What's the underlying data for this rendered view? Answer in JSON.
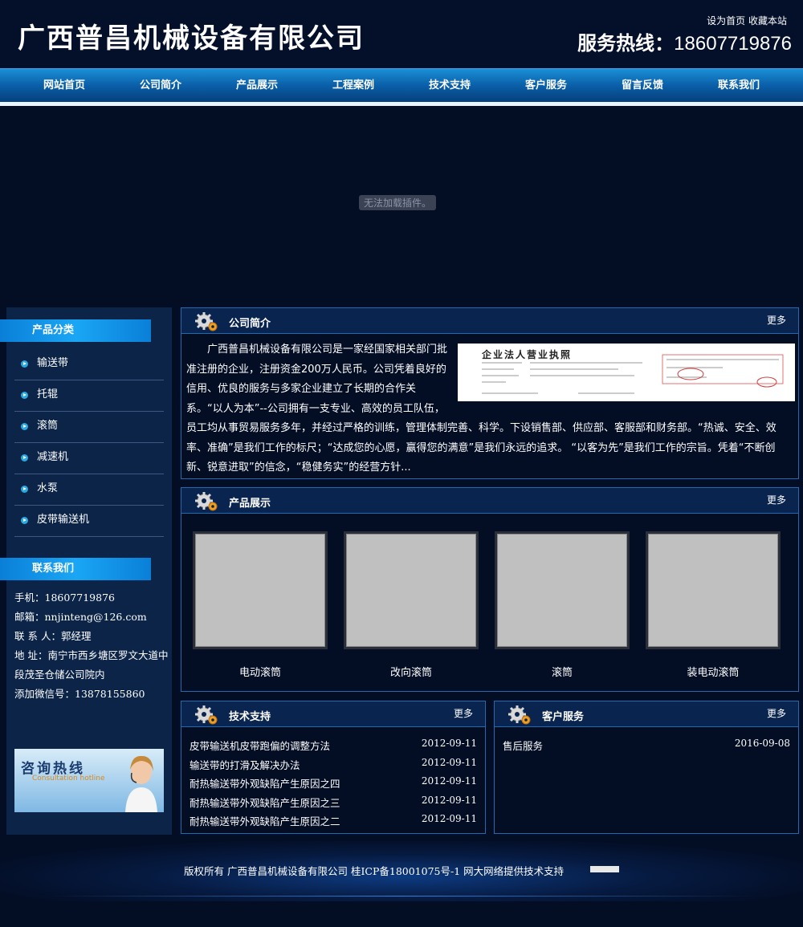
{
  "site": {
    "title": "广西普昌机械设备有限公司",
    "top_links": [
      "设为首页",
      "收藏本站"
    ],
    "hotline_label": "服务热线：",
    "hotline_number": "18607719876"
  },
  "nav": [
    "网站首页",
    "公司简介",
    "产品展示",
    "工程案例",
    "技术支持",
    "客户服务",
    "留言反馈",
    "联系我们"
  ],
  "banner": {
    "plugin_message": "无法加载插件。"
  },
  "sidebar": {
    "categories_title": "产品分类",
    "categories": [
      "输送带",
      "托辊",
      "滚筒",
      "减速机",
      "水泵",
      "皮带输送机"
    ],
    "contact_title": "联系我们",
    "contact": {
      "phone": "手机：18607719876",
      "email": "邮箱：nnjinteng@126.com",
      "person": "联 系 人：郭经理",
      "address": "地 址：南宁市西乡塘区罗文大道中段茂圣仓储公司院内",
      "wechat": "添加微信号：13878155860"
    },
    "consult_title": "咨询热线",
    "consult_sub": "Consultation hotline"
  },
  "intro": {
    "title": "公司简介",
    "more": "更多",
    "license_caption": "企业法人营业执照",
    "text": "广西普昌机械设备有限公司是一家经国家相关部门批准注册的企业，注册资金200万人民币。公司凭着良好的信用、优良的服务与多家企业建立了长期的合作关系。“以人为本”--公司拥有一支专业、高效的员工队伍，员工均从事贸易服务多年，并经过严格的训练，管理体制完善、科学。下设销售部、供应部、客服部和财务部。“热诚、安全、效率、准确”是我们工作的标尺；“达成您的心愿，赢得您的满意”是我们永远的追求。 “以客为先”是我们工作的宗旨。凭着“不断创新、锐意进取”的信念，“稳健务实”的经营方针..."
  },
  "products": {
    "title": "产品展示",
    "more": "更多",
    "items": [
      "电动滚筒",
      "改向滚筒",
      "滚筒",
      "装电动滚筒"
    ]
  },
  "tech": {
    "title": "技术支持",
    "more": "更多",
    "items": [
      {
        "title": "皮带输送机皮带跑偏的调整方法",
        "date": "2012-09-11"
      },
      {
        "title": "输送带的打滑及解决办法",
        "date": "2012-09-11"
      },
      {
        "title": "耐热输送带外观缺陷产生原因之四",
        "date": "2012-09-11"
      },
      {
        "title": "耐热输送带外观缺陷产生原因之三",
        "date": "2012-09-11"
      },
      {
        "title": "耐热输送带外观缺陷产生原因之二",
        "date": "2012-09-11"
      }
    ]
  },
  "service": {
    "title": "客户服务",
    "more": "更多",
    "items": [
      {
        "title": "售后服务",
        "date": "2016-09-08"
      }
    ]
  },
  "footer": {
    "text": "版权所有 广西普昌机械设备有限公司 桂ICP备18001075号-1 网大网络提供技术支持"
  }
}
